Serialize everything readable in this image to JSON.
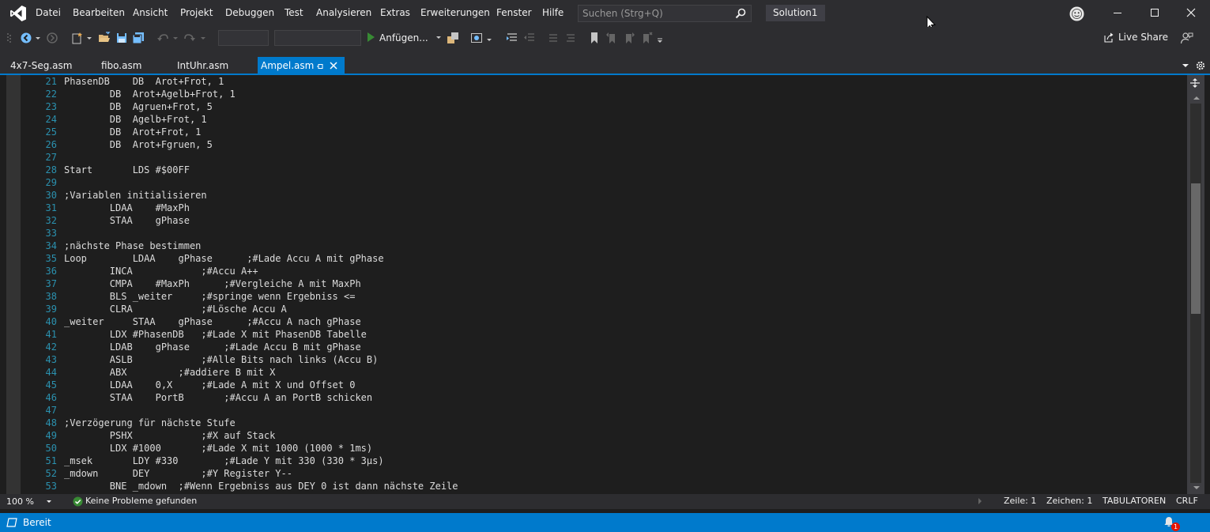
{
  "menu": {
    "items": [
      "Datei",
      "Bearbeiten",
      "Ansicht",
      "Projekt",
      "Debuggen",
      "Test",
      "Analysieren",
      "Extras",
      "Erweiterungen",
      "Fenster",
      "Hilfe"
    ],
    "search_placeholder": "Suchen (Strg+Q)",
    "solution": "Solution1"
  },
  "toolbar": {
    "attach_label": "Anfügen...",
    "live_share": "Live Share"
  },
  "tabs": [
    {
      "label": "4x7-Seg.asm",
      "active": false
    },
    {
      "label": "fibo.asm",
      "active": false
    },
    {
      "label": "IntUhr.asm",
      "active": false
    },
    {
      "label": "Ampel.asm",
      "active": true
    }
  ],
  "editor": {
    "line_numbers": [
      "21",
      "22",
      "23",
      "24",
      "25",
      "26",
      "27",
      "28",
      "29",
      "30",
      "31",
      "32",
      "33",
      "34",
      "35",
      "36",
      "37",
      "38",
      "39",
      "40",
      "41",
      "42",
      "43",
      "44",
      "45",
      "46",
      "47",
      "48",
      "49",
      "50",
      "51",
      "52",
      "53"
    ],
    "lines": [
      "PhasenDB    DB  Arot+Frot, 1",
      "        DB  Arot+Agelb+Frot, 1",
      "        DB  Agruen+Frot, 5",
      "        DB  Agelb+Frot, 1",
      "        DB  Arot+Frot, 1",
      "        DB  Arot+Fgruen, 5",
      "",
      "Start       LDS #$00FF",
      "",
      ";Variablen initialisieren",
      "        LDAA    #MaxPh",
      "        STAA    gPhase",
      "",
      ";nächste Phase bestimmen",
      "Loop        LDAA    gPhase      ;#Lade Accu A mit gPhase",
      "        INCA            ;#Accu A++",
      "        CMPA    #MaxPh      ;#Vergleiche A mit MaxPh",
      "        BLS _weiter     ;#springe wenn Ergebniss <=",
      "        CLRA            ;#Lösche Accu A",
      "_weiter     STAA    gPhase      ;#Accu A nach gPhase",
      "        LDX #PhasenDB   ;#Lade X mit PhasenDB Tabelle",
      "        LDAB    gPhase      ;#Lade Accu B mit gPhase",
      "        ASLB            ;#Alle Bits nach links (Accu B)",
      "        ABX         ;#addiere B mit X",
      "        LDAA    0,X     ;#Lade A mit X und Offset 0",
      "        STAA    PortB       ;#Accu A an PortB schicken",
      "",
      ";Verzögerung für nächste Stufe",
      "        PSHX            ;#X auf Stack",
      "        LDX #1000       ;#Lade X mit 1000 (1000 * 1ms)",
      "_msek       LDY #330        ;#Lade Y mit 330 (330 * 3µs)",
      "_mdown      DEY         ;#Y Register Y--",
      "        BNE _mdown  ;#Wenn Ergebniss aus DEY 0 ist dann nächste Zeile"
    ]
  },
  "infobar": {
    "zoom": "100 %",
    "issues": "Keine Probleme gefunden",
    "row": "Zeile: 1",
    "col": "Zeichen: 1",
    "indent": "TABULATOREN",
    "eol": "CRLF"
  },
  "statusbar": {
    "text": "Bereit",
    "notifications": "1"
  },
  "colors": {
    "accent": "#007acc",
    "chrome": "#2d2d30",
    "editor_bg": "#1e1e1e",
    "line_number": "#2b91af",
    "vs_purple": "#ffffff",
    "play_green": "#388a34"
  }
}
